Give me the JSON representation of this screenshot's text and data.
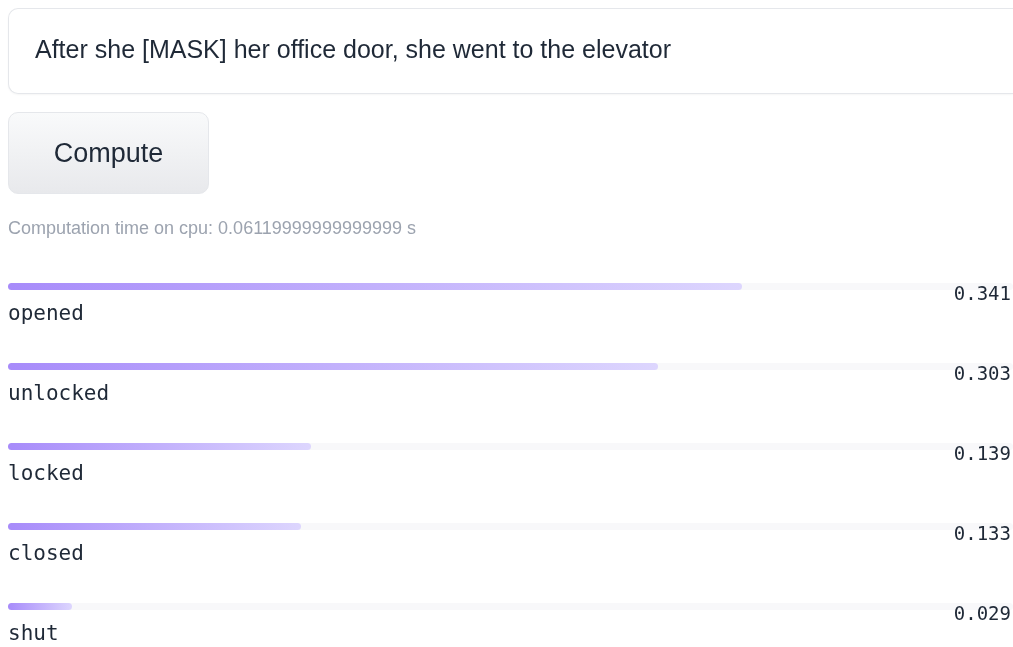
{
  "input": {
    "value": "After she [MASK] her office door, she went to the elevator"
  },
  "button": {
    "label": "Compute"
  },
  "computation_time": "Computation time on cpu: 0.06119999999999999 s",
  "results": [
    {
      "label": "opened",
      "score": "0.341",
      "level": 0.73
    },
    {
      "label": "unlocked",
      "score": "0.303",
      "level": 0.647
    },
    {
      "label": "locked",
      "score": "0.139",
      "level": 0.301
    },
    {
      "label": "closed",
      "score": "0.133",
      "level": 0.292
    },
    {
      "label": "shut",
      "score": "0.029",
      "level": 0.064
    }
  ]
}
